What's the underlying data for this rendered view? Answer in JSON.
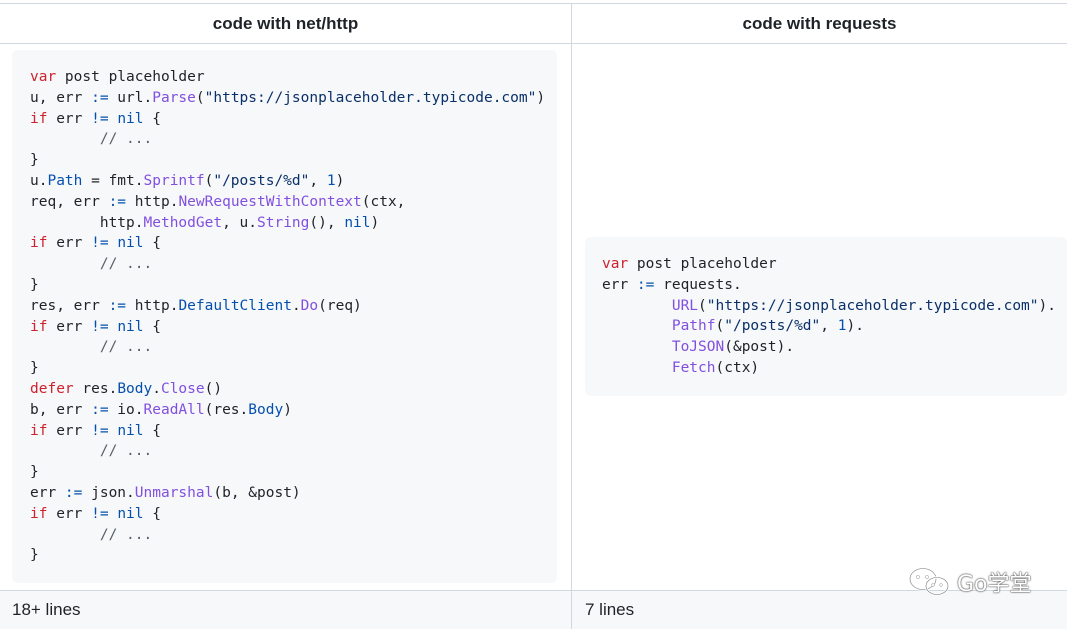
{
  "table": {
    "headers": {
      "left": "code with net/http",
      "right": "code with requests"
    },
    "footer": {
      "left": "18+ lines",
      "right": "7 lines"
    }
  },
  "code_left": [
    [
      [
        "k",
        "var"
      ],
      [
        "t",
        " post placeholder"
      ]
    ],
    [
      [
        "t",
        "u, err "
      ],
      [
        "p",
        ":="
      ],
      [
        "t",
        " url."
      ],
      [
        "f",
        "Parse"
      ],
      [
        "t",
        "("
      ],
      [
        "s",
        "\"https://jsonplaceholder.typicode.com\""
      ],
      [
        "t",
        ")"
      ]
    ],
    [
      [
        "k",
        "if"
      ],
      [
        "t",
        " err "
      ],
      [
        "p",
        "!="
      ],
      [
        "t",
        " "
      ],
      [
        "p",
        "nil"
      ],
      [
        "t",
        " {"
      ]
    ],
    [
      [
        "c",
        "        // ..."
      ]
    ],
    [
      [
        "t",
        "}"
      ]
    ],
    [
      [
        "t",
        "u."
      ],
      [
        "p",
        "Path"
      ],
      [
        "t",
        " = fmt."
      ],
      [
        "f",
        "Sprintf"
      ],
      [
        "t",
        "("
      ],
      [
        "s",
        "\"/posts/%d\""
      ],
      [
        "t",
        ", "
      ],
      [
        "p",
        "1"
      ],
      [
        "t",
        ")"
      ]
    ],
    [
      [
        "t",
        "req, err "
      ],
      [
        "p",
        ":="
      ],
      [
        "t",
        " http."
      ],
      [
        "f",
        "NewRequestWithContext"
      ],
      [
        "t",
        "(ctx,"
      ]
    ],
    [
      [
        "t",
        "        http."
      ],
      [
        "f",
        "MethodGet"
      ],
      [
        "t",
        ", u."
      ],
      [
        "f",
        "String"
      ],
      [
        "t",
        "(), "
      ],
      [
        "p",
        "nil"
      ],
      [
        "t",
        ")"
      ]
    ],
    [
      [
        "k",
        "if"
      ],
      [
        "t",
        " err "
      ],
      [
        "p",
        "!="
      ],
      [
        "t",
        " "
      ],
      [
        "p",
        "nil"
      ],
      [
        "t",
        " {"
      ]
    ],
    [
      [
        "c",
        "        // ..."
      ]
    ],
    [
      [
        "t",
        "}"
      ]
    ],
    [
      [
        "t",
        "res, err "
      ],
      [
        "p",
        ":="
      ],
      [
        "t",
        " http."
      ],
      [
        "p",
        "DefaultClient"
      ],
      [
        "t",
        "."
      ],
      [
        "f",
        "Do"
      ],
      [
        "t",
        "(req)"
      ]
    ],
    [
      [
        "k",
        "if"
      ],
      [
        "t",
        " err "
      ],
      [
        "p",
        "!="
      ],
      [
        "t",
        " "
      ],
      [
        "p",
        "nil"
      ],
      [
        "t",
        " {"
      ]
    ],
    [
      [
        "c",
        "        // ..."
      ]
    ],
    [
      [
        "t",
        "}"
      ]
    ],
    [
      [
        "k",
        "defer"
      ],
      [
        "t",
        " res."
      ],
      [
        "p",
        "Body"
      ],
      [
        "t",
        "."
      ],
      [
        "f",
        "Close"
      ],
      [
        "t",
        "()"
      ]
    ],
    [
      [
        "t",
        "b, err "
      ],
      [
        "p",
        ":="
      ],
      [
        "t",
        " io."
      ],
      [
        "f",
        "ReadAll"
      ],
      [
        "t",
        "(res."
      ],
      [
        "p",
        "Body"
      ],
      [
        "t",
        ")"
      ]
    ],
    [
      [
        "k",
        "if"
      ],
      [
        "t",
        " err "
      ],
      [
        "p",
        "!="
      ],
      [
        "t",
        " "
      ],
      [
        "p",
        "nil"
      ],
      [
        "t",
        " {"
      ]
    ],
    [
      [
        "c",
        "        // ..."
      ]
    ],
    [
      [
        "t",
        "}"
      ]
    ],
    [
      [
        "t",
        "err "
      ],
      [
        "p",
        ":="
      ],
      [
        "t",
        " json."
      ],
      [
        "f",
        "Unmarshal"
      ],
      [
        "t",
        "(b, &post)"
      ]
    ],
    [
      [
        "k",
        "if"
      ],
      [
        "t",
        " err "
      ],
      [
        "p",
        "!="
      ],
      [
        "t",
        " "
      ],
      [
        "p",
        "nil"
      ],
      [
        "t",
        " {"
      ]
    ],
    [
      [
        "c",
        "        // ..."
      ]
    ],
    [
      [
        "t",
        "}"
      ]
    ]
  ],
  "code_right": [
    [
      [
        "k",
        "var"
      ],
      [
        "t",
        " post placeholder"
      ]
    ],
    [
      [
        "t",
        "err "
      ],
      [
        "p",
        ":="
      ],
      [
        "t",
        " requests."
      ]
    ],
    [
      [
        "t",
        "        "
      ],
      [
        "f",
        "URL"
      ],
      [
        "t",
        "("
      ],
      [
        "s",
        "\"https://jsonplaceholder.typicode.com\""
      ],
      [
        "t",
        ")."
      ]
    ],
    [
      [
        "t",
        "        "
      ],
      [
        "f",
        "Pathf"
      ],
      [
        "t",
        "("
      ],
      [
        "s",
        "\"/posts/%d\""
      ],
      [
        "t",
        ", "
      ],
      [
        "p",
        "1"
      ],
      [
        "t",
        ")."
      ]
    ],
    [
      [
        "t",
        "        "
      ],
      [
        "f",
        "ToJSON"
      ],
      [
        "t",
        "(&post)."
      ]
    ],
    [
      [
        "t",
        "        "
      ],
      [
        "f",
        "Fetch"
      ],
      [
        "t",
        "(ctx)"
      ]
    ]
  ],
  "watermark": {
    "text": "Go学堂",
    "icon": "wechat-icon"
  },
  "colors": {
    "keyword": "#cf222e",
    "function": "#8250df",
    "constant": "#0550ae",
    "string": "#0a3069",
    "comment": "#57606a",
    "code_bg": "#f6f8fa",
    "border": "#d0d7de"
  }
}
